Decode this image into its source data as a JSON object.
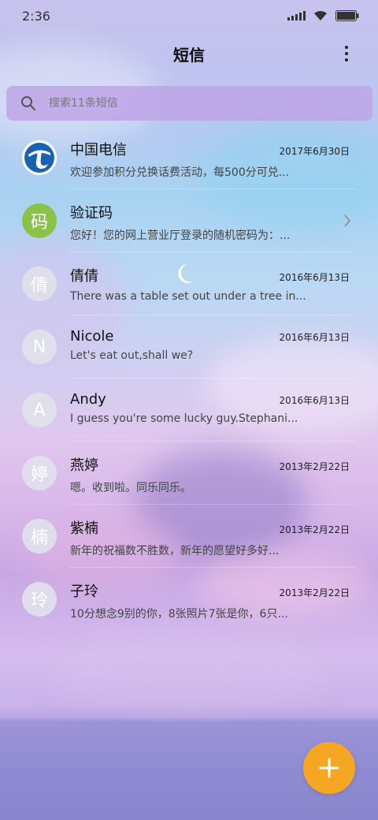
{
  "status_bar": {
    "time": "2:36",
    "icons": [
      "signal-icon",
      "wifi-icon",
      "battery-icon"
    ]
  },
  "app_bar": {
    "title": "短信",
    "more_icon": "more-vertical-icon"
  },
  "search": {
    "placeholder": "搜索11条短信",
    "icon": "search-icon"
  },
  "conversations": [
    {
      "name": "中国电信",
      "date": "2017年6月30日",
      "preview": "欢迎参加积分兑换话费活动，每500分可兑...",
      "avatar": "china-telecom-logo",
      "avatar_text": ""
    },
    {
      "name": "验证码",
      "date": "",
      "preview": "您好！您的网上营业厅登录的随机密码为：...",
      "avatar_text": "码",
      "avatar_color": "#8bc34a"
    },
    {
      "name": "倩倩",
      "date": "2016年6月13日",
      "preview": "There was a table set out under a tree in...",
      "avatar_text": "倩"
    },
    {
      "name": "Nicole",
      "date": "2016年6月13日",
      "preview": "Let's eat out,shall we?",
      "avatar_text": "N"
    },
    {
      "name": "Andy",
      "date": "2016年6月13日",
      "preview": "I guess you're some lucky guy.Stephani...",
      "avatar_text": "A"
    },
    {
      "name": "燕婷",
      "date": "2013年2月22日",
      "preview": "嗯。收到啦。同乐同乐。",
      "avatar_text": "婷"
    },
    {
      "name": "紫楠",
      "date": "2013年2月22日",
      "preview": "新年的祝福数不胜数，新年的愿望好多好...",
      "avatar_text": "楠"
    },
    {
      "name": "子玲",
      "date": "2013年2月22日",
      "preview": "10分想念9别的你，8张照片7张是你，6只...",
      "avatar_text": "玲"
    }
  ],
  "fab": {
    "icon": "plus-icon",
    "color": "#f5a623"
  }
}
